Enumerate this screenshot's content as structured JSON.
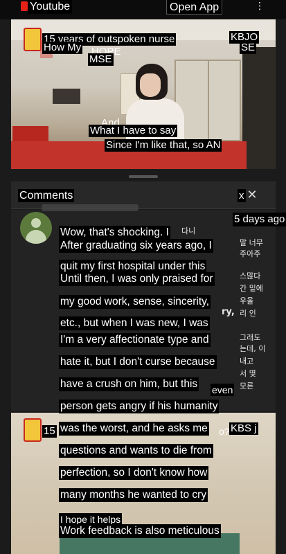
{
  "topbar": {
    "app_name": "Youtube",
    "open_app": "Open App",
    "menu_icon": "kebab-menu-icon"
  },
  "video": {
    "subtitles": [
      "15 years of outspoken nurse",
      "How My",
      "HOPE",
      "MSE",
      "KBJO",
      "SE",
      "And",
      "What I have to say",
      "Since I'm like that, so AN"
    ]
  },
  "comments": {
    "title": "Comments",
    "close_label": "x",
    "time": "5 days ago",
    "lines": [
      "Wow, that's shocking. I",
      "After graduating six years ago, I",
      "quit my first hospital under this",
      "Until then, I was only praised for",
      "my good work, sense, sincerity,",
      "etc., but when I was new, I was",
      "I'm a very affectionate type and",
      "hate it, but I don't curse because",
      "have a crush on him, but this",
      "person gets angry if his humanity",
      "was the worst, and he asks me",
      "questions and wants to die from",
      "perfection, so I don't know how",
      "many months he wanted to cry",
      "I hope it helps",
      "Work feedback is also meticulous"
    ],
    "korean_fragments": [
      "다니",
      "말 너무",
      "주아주",
      "스많다",
      "간 밑에",
      "우울",
      "ry,",
      "리 인",
      "그래도",
      "는데, 이",
      "내고",
      "서 몇",
      "even",
      "모른",
      "o?"
    ]
  },
  "video2": {
    "overlay_left": "15",
    "overlay_right": "KBS j"
  }
}
